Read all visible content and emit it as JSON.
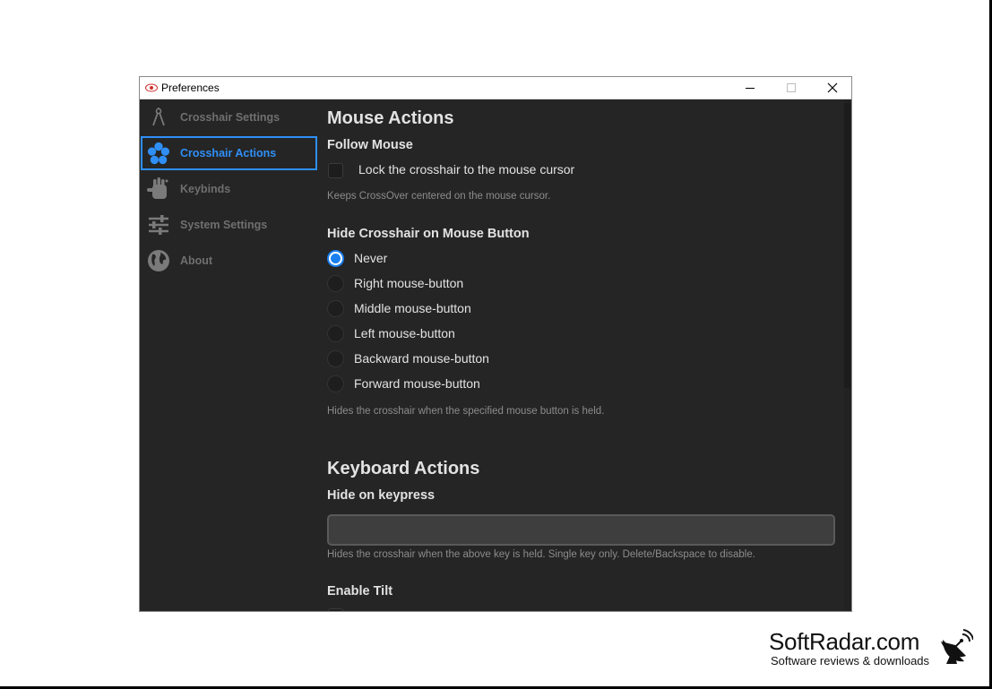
{
  "window": {
    "title": "Preferences"
  },
  "sidebar": {
    "items": [
      {
        "label": "Crosshair Settings",
        "icon": "compass-icon"
      },
      {
        "label": "Crosshair Actions",
        "icon": "flower-icon",
        "active": true
      },
      {
        "label": "Keybinds",
        "icon": "hand-icon"
      },
      {
        "label": "System Settings",
        "icon": "sliders-icon"
      },
      {
        "label": "About",
        "icon": "globe-icon"
      }
    ],
    "accent": "#2f8ff7"
  },
  "mouse_actions": {
    "heading": "Mouse Actions",
    "follow_mouse": {
      "heading": "Follow Mouse",
      "checkbox_label": "Lock the crosshair to the mouse cursor",
      "checked": false,
      "description": "Keeps CrossOver centered on the mouse cursor."
    },
    "hide_on_button": {
      "heading": "Hide Crosshair on Mouse Button",
      "options": [
        {
          "label": "Never",
          "selected": true
        },
        {
          "label": "Right mouse-button",
          "selected": false
        },
        {
          "label": "Middle mouse-button",
          "selected": false
        },
        {
          "label": "Left mouse-button",
          "selected": false
        },
        {
          "label": "Backward mouse-button",
          "selected": false
        },
        {
          "label": "Forward mouse-button",
          "selected": false
        }
      ],
      "description": "Hides the crosshair when the specified mouse button is held."
    }
  },
  "keyboard_actions": {
    "heading": "Keyboard Actions",
    "hide_on_keypress": {
      "heading": "Hide on keypress",
      "value": "",
      "description": "Hides the crosshair when the above key is held. Single key only. Delete/Backspace to disable."
    },
    "enable_tilt": {
      "heading": "Enable Tilt"
    }
  },
  "watermark": {
    "title": "SoftRadar.com",
    "subtitle": "Software reviews & downloads"
  },
  "colors": {
    "background": "#252525",
    "text": "#e2e2e2",
    "muted": "#8c8c8c",
    "radio_selected": "#1a80f0"
  }
}
